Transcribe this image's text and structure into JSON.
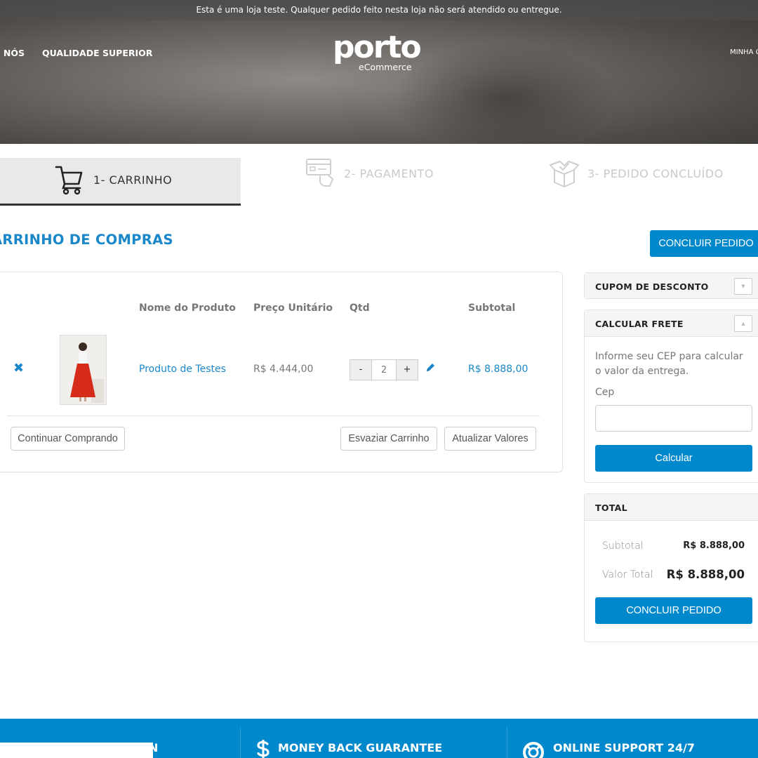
{
  "topbar": {
    "notice": "Esta é uma loja teste. Qualquer pedido feito nesta loja não será atendido ou entregue."
  },
  "nav": {
    "sobre": "E NÓS",
    "qualidade": "QUALIDADE SUPERIOR",
    "minha": "MINHA C"
  },
  "logo": {
    "main": "porto",
    "sub": "eCommerce"
  },
  "steps": [
    {
      "label": "1- CARRINHO",
      "icon": "shopping-cart-icon"
    },
    {
      "label": "2- PAGAMENTO",
      "icon": "credit-card-icon"
    },
    {
      "label": "3- PEDIDO CONCLUÍDO",
      "icon": "open-box-icon"
    }
  ],
  "page": {
    "title": "ARRINHO DE COMPRAS",
    "checkout_top": "CONCLUIR PEDIDO"
  },
  "cart": {
    "columns": {
      "name": "Nome do Produto",
      "price": "Preço Unitário",
      "qty": "Qtd",
      "subtotal": "Subtotal"
    },
    "items": [
      {
        "name": "Produto de Testes",
        "unit_price": "R$ 4.444,00",
        "qty": "2",
        "subtotal": "R$ 8.888,00"
      }
    ],
    "qty_minus": "-",
    "qty_plus": "+",
    "remove_symbol": "✖",
    "buttons": {
      "continue": "Continuar Comprando",
      "empty": "Esvaziar Carrinho",
      "update": "Atualizar Valores"
    }
  },
  "sidebar": {
    "cupom": {
      "title": "CUPOM DE DESCONTO",
      "toggle": "▼"
    },
    "frete": {
      "title": "CALCULAR FRETE",
      "toggle": "▲",
      "text": "Informe seu CEP para calcular o valor da entrega.",
      "cep_label": "Cep",
      "button": "Calcular"
    },
    "total": {
      "title": "TOTAL",
      "subtotal_label": "Subtotal",
      "subtotal_value": "R$ 8.888,00",
      "total_label": "Valor Total",
      "total_value": "R$ 8.888,00",
      "button": "CONCLUIR PEDIDO"
    }
  },
  "footer": {
    "first": "N",
    "money": "MONEY BACK GUARANTEE",
    "support": "ONLINE SUPPORT 24/7"
  },
  "colors": {
    "accent": "#0088cc",
    "link": "#1a87c8",
    "text": "#777777"
  }
}
